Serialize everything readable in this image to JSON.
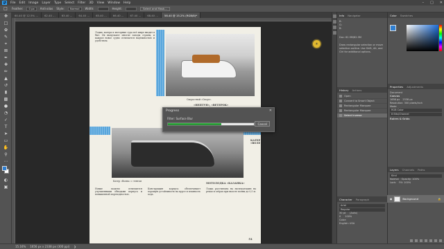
{
  "menubar": {
    "items": [
      "File",
      "Edit",
      "Image",
      "Layer",
      "Type",
      "Select",
      "Filter",
      "3D",
      "View",
      "Window",
      "Help"
    ],
    "logo": "Ps"
  },
  "options": {
    "feather_label": "Feather:",
    "feather_value": "0 px",
    "antialias_label": "Anti-alias",
    "style_label": "Style:",
    "style_value": "Normal",
    "width_label": "Width:",
    "height_label": "Height:",
    "select_mask_label": "Select and Mask..."
  },
  "tabs": [
    {
      "label": "60.40 @ 12.5% ..."
    },
    {
      "label": "62.40 ..."
    },
    {
      "label": "63.40 ..."
    },
    {
      "label": "64.40 ..."
    },
    {
      "label": "65.40 ..."
    },
    {
      "label": "66.40 ..."
    },
    {
      "label": "67.40 ..."
    },
    {
      "label": "68.40 ..."
    },
    {
      "label": "58.40 @ 15.2% (RGB/8)*"
    }
  ],
  "document": {
    "caption_top": "Скоростной «Спорт».",
    "heading_main": "«НЕПТУН», «ВЕТЕРОК»",
    "heading_boat": "КАТЕР «ВОЛНА»",
    "heading_motor": "МОТОЛОДКА «КАЗАНКА»",
    "caption_bottom": "Катер «Волна» с тентом",
    "page_number": "51",
    "text_left_top": "Лодки, катера и моторные суда всё шире входят в быт. Их выпускают многие заводы страны, и каждое новое судно отличается надёжностью и удобством.",
    "text_mid": "Мотолодки строятся из лёгких сплавов, а корпус рассчитан на большие нагрузки при движении по волне. Двигатели устанавливаются подвесные.",
    "text_specs": "Длина, м ........ 4,6\nШирина, м ....... 1,6\nВысота борта, м . 0,6\nМасса, кг ....... 240\nСкорость, км/ч .. 40",
    "text_bottom_left": "Новые модели отличаются улучшенными обводами корпуса и повышенной мореходностью.",
    "text_bottom_mid": "Конструкция корпуса обеспечивает хорошую устойчивость на курсе и плавность хода.",
    "text_bottom_right": "Лодка рассчитана на эксплуатацию на реках и озёрах при высоте волны до 0,5 м."
  },
  "progress": {
    "title": "Progress",
    "message": "Filter: Surface Blur",
    "value": 0.62,
    "cancel_label": "Cancel"
  },
  "status": {
    "zoom": "15.16%",
    "dimensions": "1656 px x 2338 px (300 ppi)"
  },
  "info_panel": {
    "tabs": [
      "Info",
      "Navigator"
    ],
    "rgb": "R:\nG:\nB:",
    "doc": "Doc: 62.9M/62.9M",
    "hint": "Draw rectangular selection or move selection outline. Use Shift, Alt, and Ctrl for additional options."
  },
  "history_panel": {
    "tabs": [
      "History",
      "Actions"
    ],
    "items": [
      "Open",
      "Convert to Smart Object",
      "Rectangular Marquee",
      "Rectangular Marquee",
      "Select Inverse"
    ],
    "selected_index": 4
  },
  "color_panel": {
    "tabs": [
      "Color",
      "Swatches"
    ],
    "fg_color": "#2f7fd1"
  },
  "properties_panel": {
    "tabs": [
      "Properties",
      "Adjustments"
    ],
    "doc_label": "Document",
    "canvas_label": "Canvas",
    "w_value": "1656 px",
    "h_value": "2338 px",
    "res_label": "Resolution: 300 pixels/inch",
    "mode_label": "Mode",
    "mode_value": "RGB Color",
    "depth_value": "8 Bits/Channel",
    "rulers_label": "Rulers & Grids"
  },
  "layers_panel": {
    "tabs": [
      "Layers",
      "Channels",
      "Paths"
    ],
    "kind_label": "Kind",
    "blend_value": "Normal",
    "opacity_label": "Opacity: 100%",
    "lock_label": "Lock:",
    "fill_label": "Fill: 100%",
    "layer_name": "Background"
  },
  "character_panel": {
    "tabs": [
      "Character",
      "Paragraph"
    ],
    "font_value": "Arial",
    "style_value": "Regular",
    "size_value": "30 pt",
    "leading_value": "(Auto)",
    "tracking_value": "0",
    "scale_value": "100%",
    "color_label": "Color:",
    "lang_value": "English: USA"
  }
}
